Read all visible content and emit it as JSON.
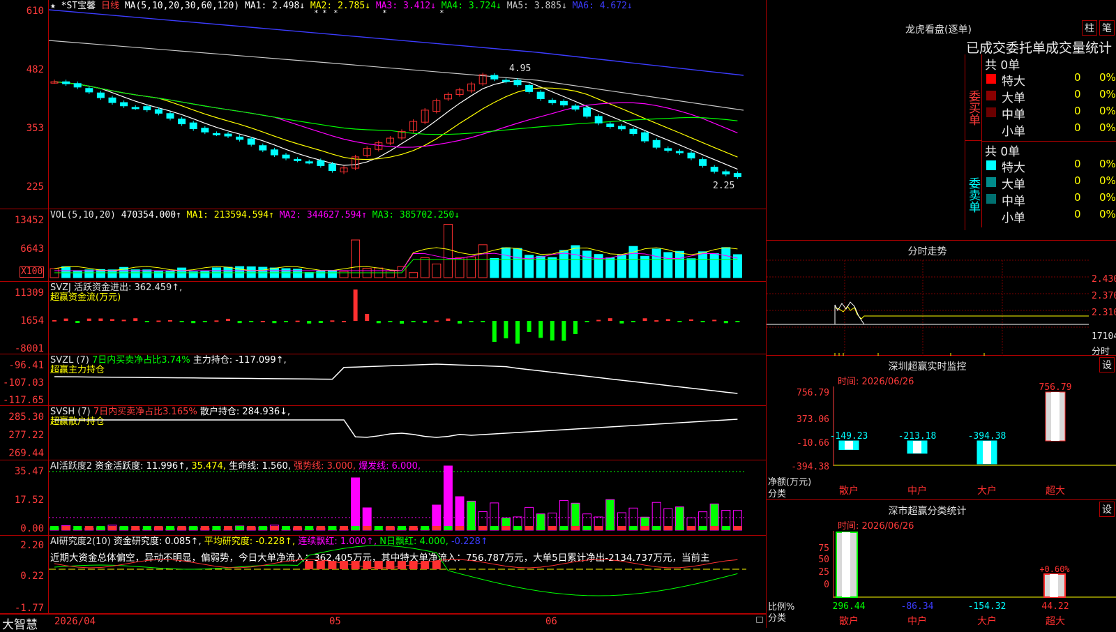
{
  "main_chart": {
    "star": "★",
    "stock_name": "*ST宝馨",
    "period": "日线",
    "ma_params": "MA(5,10,20,30,60,120)",
    "ma_values": [
      {
        "label": "MA1:",
        "value": "2.498↓",
        "color": "#ffffff"
      },
      {
        "label": "MA2:",
        "value": "2.785↓",
        "color": "#ffff00"
      },
      {
        "label": "MA3:",
        "value": "3.412↓",
        "color": "#ff00ff"
      },
      {
        "label": "MA4:",
        "value": "3.724↓",
        "color": "#00ff00"
      },
      {
        "label": "MA5:",
        "value": "3.885↓",
        "color": "#c8c8c8"
      },
      {
        "label": "MA6:",
        "value": "4.672↓",
        "color": "#3c3cff"
      }
    ],
    "y_ticks": [
      "610",
      "482",
      "353",
      "225"
    ],
    "high_label": "4.95",
    "low_label": "2.25"
  },
  "vol_panel": {
    "header": "VOL(5,10,20)",
    "vol": "470354.000↑",
    "ma1": "MA1: 213594.594↑",
    "ma2": "MA2: 344627.594↑",
    "ma3": "MA3: 385702.250↓",
    "y_ticks": [
      "13452",
      "6643"
    ],
    "unit": "X100"
  },
  "svzj_panel": {
    "header": "SVZJ  活跃资金进出: 362.459↑,",
    "subtitle": "超赢资金流(万元)",
    "y_ticks": [
      "11309",
      "1654",
      "-8001"
    ]
  },
  "svzl_panel": {
    "name": "SVZL (7)",
    "text1": "7日内买卖净占比3.74%",
    "text2": "主力持仓: -117.099↑,",
    "subtitle": "超赢主力持仓",
    "y_ticks": [
      "-96.41",
      "-107.03",
      "-117.65"
    ]
  },
  "svsh_panel": {
    "name": "SVSH (7)",
    "text1": "7日内买卖净占比3.165%",
    "text2": "散户持仓: 284.936↓,",
    "subtitle": "超赢散户持仓",
    "y_ticks": [
      "285.30",
      "277.22",
      "269.44"
    ]
  },
  "ai_active_panel": {
    "name": "AI活跃度2",
    "t1": "资金活跃度: 11.996↑,",
    "t2": "35.474,",
    "t3": "生命线: 1.560,",
    "t4": "强势线: 3.000,",
    "t5": "爆发线: 6.000,",
    "y_ticks": [
      "35.47",
      "17.52",
      "0.00"
    ]
  },
  "ai_research_panel": {
    "name": "AI研究度2(10)",
    "t1": "资金研究度: 0.085↑,",
    "t2": "平均研究度: -0.228↑,",
    "t3": "连续飘红: 1.000↑,",
    "t4": "N日飘红: 4.000,",
    "t5": "-0.228↑",
    "summary": "近期大资金总体偏空，异动不明显，偏弱势，今日大单净流入：362.405万元，其中特大单净流入：756.787万元，大单5日累计净出-2134.737万元，当前主",
    "y_ticks": [
      "2.20",
      "0.22",
      "-1.77"
    ]
  },
  "bottom_bar": {
    "brand": "大智慧",
    "dates": [
      "2026/04",
      "05",
      "06"
    ]
  },
  "dragon_panel": {
    "title": "龙虎看盘(逐单)",
    "btn_bar": "柱",
    "btn_bi": "笔",
    "subtitle": "已成交委托单成交量统计",
    "buy_label": "委买单",
    "sell_label": "委卖单",
    "buy_total": "共 0单",
    "sell_total": "共 0单",
    "buy_rows": [
      {
        "label": "特大",
        "value": "0",
        "pct": "0%",
        "color": "#ff0000"
      },
      {
        "label": "大单",
        "value": "0",
        "pct": "0%",
        "color": "#8b0000"
      },
      {
        "label": "中单",
        "value": "0",
        "pct": "0%",
        "color": "#6b0000"
      },
      {
        "label": "小单",
        "value": "0",
        "pct": "0%",
        "color": ""
      }
    ],
    "sell_rows": [
      {
        "label": "特大",
        "value": "0",
        "pct": "0%",
        "color": "#00ffff"
      },
      {
        "label": "大单",
        "value": "0",
        "pct": "0%",
        "color": "#008b8b"
      },
      {
        "label": "中单",
        "value": "0",
        "pct": "0%",
        "color": "#007070"
      },
      {
        "label": "小单",
        "value": "0",
        "pct": "0%",
        "color": ""
      }
    ]
  },
  "intraday_panel": {
    "title": "分时走势",
    "prices": [
      "2.430",
      "2.370",
      "2.310"
    ],
    "volume": "17104",
    "unit": "分时"
  },
  "sz_monitor": {
    "title": "深圳超赢实时监控",
    "btn": "设",
    "time": "时间: 2026/06/26",
    "y_ticks": [
      "756.79",
      "373.06",
      "-10.66",
      "-394.38"
    ],
    "ylabel1": "净额(万元)",
    "ylabel2": "分类",
    "bars": [
      {
        "cat": "散户",
        "value": "-149.23"
      },
      {
        "cat": "中户",
        "value": "-213.18"
      },
      {
        "cat": "大户",
        "value": "-394.38"
      },
      {
        "cat": "超大",
        "value": "756.79"
      }
    ]
  },
  "sz_class": {
    "title": "深市超赢分类统计",
    "btn": "设",
    "time": "时间: 2026/06/26",
    "y_ticks": [
      "75",
      "50",
      "25",
      "0"
    ],
    "ylabel1": "比例%",
    "ylabel2": "分类",
    "pct_label": "+0.60%",
    "bars": [
      {
        "cat": "散户",
        "value": "296.44"
      },
      {
        "cat": "中户",
        "value": "-86.34"
      },
      {
        "cat": "大户",
        "value": "-154.32"
      },
      {
        "cat": "超大",
        "value": "44.22"
      }
    ]
  },
  "colors": {
    "up": "#ff3030",
    "down": "#00ffff",
    "grid": "#b00000",
    "ma1": "#ffffff",
    "ma2": "#ffff00",
    "ma3": "#ff00ff",
    "ma4": "#00ff00",
    "ma5": "#c8c8c8",
    "ma6": "#3c3cff"
  }
}
